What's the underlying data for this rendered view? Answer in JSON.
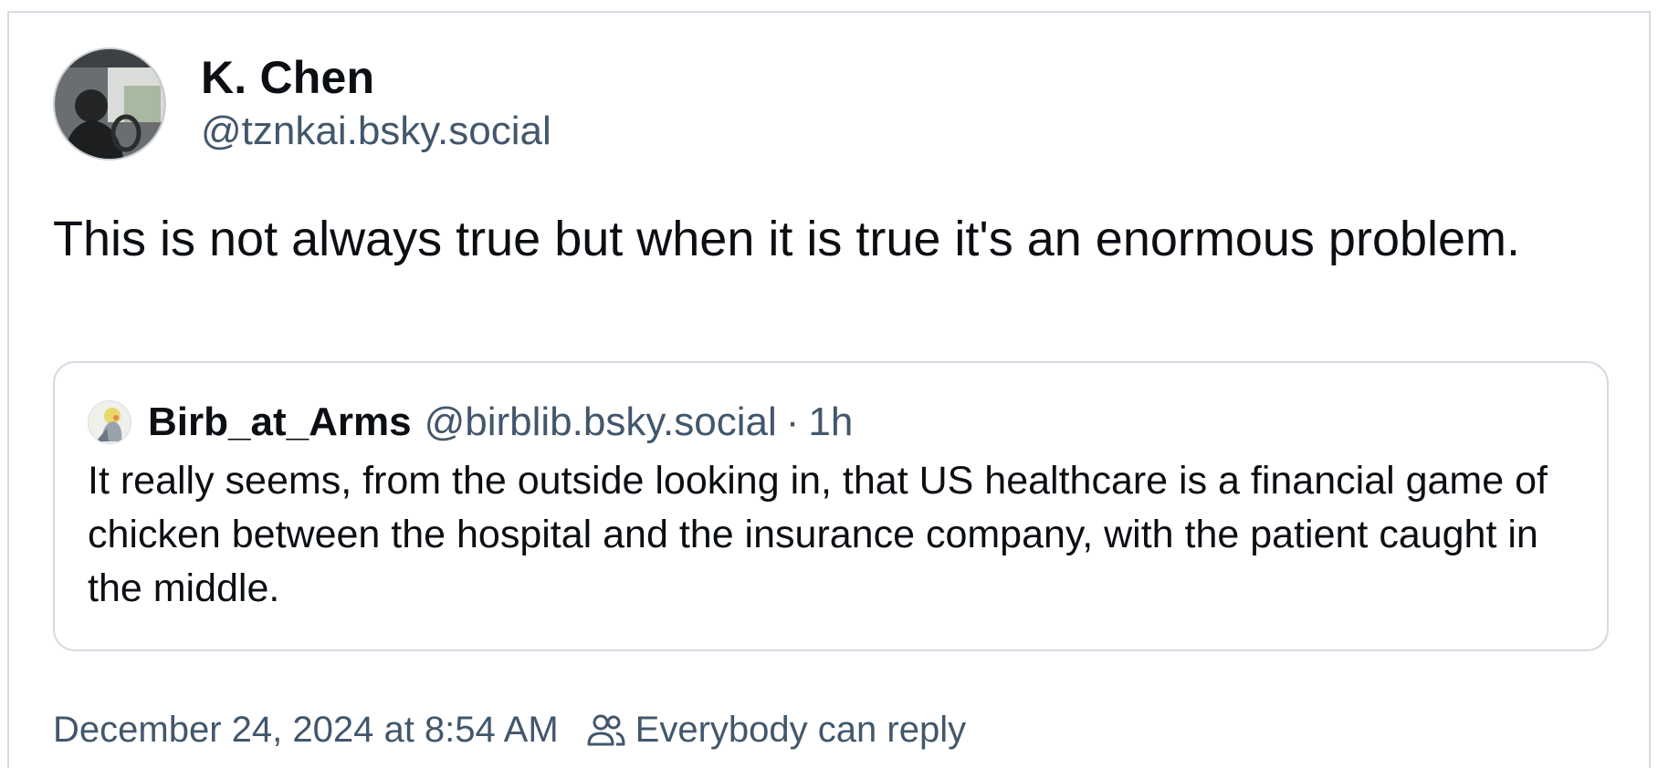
{
  "post": {
    "author": {
      "display_name": "K. Chen",
      "handle": "@tznkai.bsky.social"
    },
    "text": "This is not always true but when it is true it's an enormous problem.",
    "quote": {
      "display_name": "Birb_at_Arms",
      "handle": "@birblib.bsky.social",
      "separator": "·",
      "time": "1h",
      "text": "It really seems, from the outside looking in, that US healthcare is a financial game of chicken between the hospital and the insurance company, with the patient caught in the middle."
    },
    "timestamp": "December 24, 2024 at 8:54 AM",
    "reply_setting": "Everybody can reply"
  },
  "icons": {
    "reply_setting_icon": "people-icon"
  },
  "colors": {
    "text": "#0b0f14",
    "secondary_text": "#42576c",
    "border": "#d4dbe2"
  }
}
